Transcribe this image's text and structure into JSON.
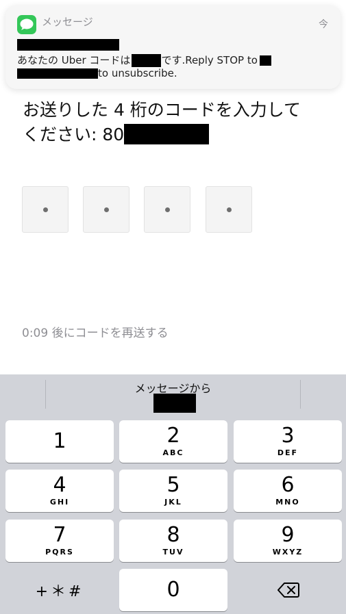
{
  "notification": {
    "app_name": "メッセージ",
    "time": "今",
    "body_line1_start": "あなたの Uber コードは",
    "body_line1_mid": "です.Reply STOP to",
    "body_line2_end": "to unsubscribe.",
    "app_icon": "messages-bubble-icon",
    "app_icon_color": "#34c759"
  },
  "prompt": {
    "line1": "お送りした 4 桁のコードを入力して",
    "line2_prefix": "ください: 80"
  },
  "code_entry": {
    "digits": [
      "•",
      "•",
      "•",
      "•"
    ]
  },
  "resend": {
    "text": "0:09 後にコードを再送する"
  },
  "keyboard": {
    "suggestion_label": "メッセージから",
    "keys": [
      {
        "digit": "1",
        "letters": ""
      },
      {
        "digit": "2",
        "letters": "ABC"
      },
      {
        "digit": "3",
        "letters": "DEF"
      },
      {
        "digit": "4",
        "letters": "GHI"
      },
      {
        "digit": "5",
        "letters": "JKL"
      },
      {
        "digit": "6",
        "letters": "MNO"
      },
      {
        "digit": "7",
        "letters": "PQRS"
      },
      {
        "digit": "8",
        "letters": "TUV"
      },
      {
        "digit": "9",
        "letters": "WXYZ"
      },
      {
        "digit": "0",
        "letters": ""
      }
    ],
    "symbols_key": "+＊#",
    "delete_icon": "backspace-icon",
    "background_color": "#d1d3d9"
  }
}
